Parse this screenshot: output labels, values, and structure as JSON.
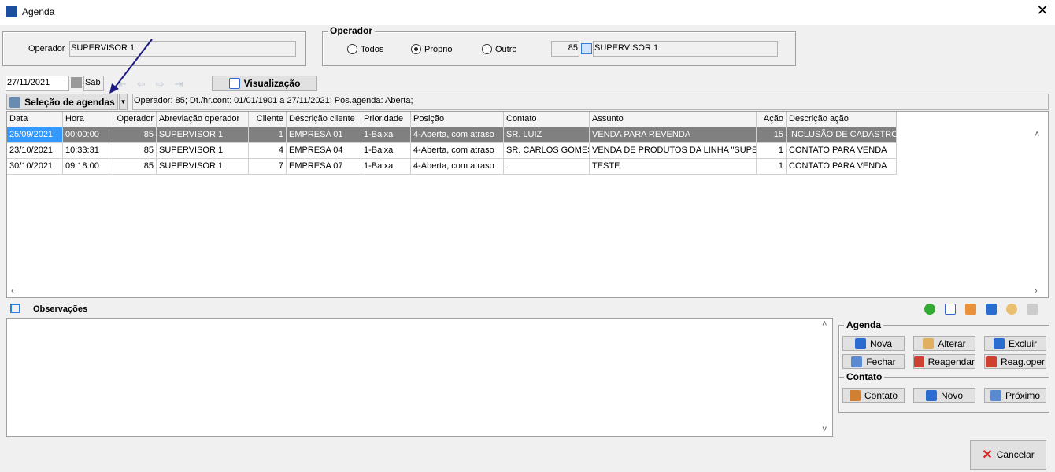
{
  "window": {
    "title": "Agenda",
    "close_icon": "close-icon"
  },
  "operator_panel": {
    "label": "Operador",
    "value": "SUPERVISOR 1"
  },
  "operator_filter": {
    "legend": "Operador",
    "options": [
      {
        "label": "Todos",
        "selected": false
      },
      {
        "label": "Próprio",
        "selected": true
      },
      {
        "label": "Outro",
        "selected": false
      }
    ],
    "code": "85",
    "name": "SUPERVISOR 1"
  },
  "date_bar": {
    "date": "27/11/2021",
    "weekday": "Sáb",
    "view_button": "Visualização"
  },
  "selection": {
    "button": "Seleção de agendas",
    "summary": "Operador: 85; Dt./hr.cont: 01/01/1901 a 27/11/2021; Pos.agenda: Aberta;"
  },
  "table": {
    "columns": [
      "Data",
      "Hora",
      "Operador",
      "Abreviação operador",
      "Cliente",
      "Descrição cliente",
      "Prioridade",
      "Posição",
      "Contato",
      "Assunto",
      "Ação",
      "Descrição ação"
    ],
    "rows": [
      [
        "25/09/2021",
        "00:00:00",
        "85",
        "SUPERVISOR 1",
        "1",
        "EMPRESA 01",
        "1-Baixa",
        "4-Aberta, com atraso",
        "SR. LUIZ",
        "VENDA PARA REVENDA",
        "15",
        "INCLUSÃO DE CADASTRO"
      ],
      [
        "23/10/2021",
        "10:33:31",
        "85",
        "SUPERVISOR 1",
        "4",
        "EMPRESA 04",
        "1-Baixa",
        "4-Aberta, com atraso",
        "SR. CARLOS GOMES",
        "VENDA DE PRODUTOS DA LINHA \"SUPER\"",
        "1",
        "CONTATO PARA VENDA"
      ],
      [
        "30/10/2021",
        "09:18:00",
        "85",
        "SUPERVISOR 1",
        "7",
        "EMPRESA 07",
        "1-Baixa",
        "4-Aberta, com atraso",
        ".",
        "TESTE",
        "1",
        "CONTATO PARA VENDA"
      ]
    ],
    "selected_row": 0
  },
  "observations": {
    "label": "Observações"
  },
  "agenda_group": {
    "legend": "Agenda",
    "buttons": [
      "Nova",
      "Alterar",
      "Excluir",
      "Fechar",
      "Reagendar",
      "Reag.oper"
    ]
  },
  "contato_group": {
    "legend": "Contato",
    "buttons": [
      "Contato",
      "Novo",
      "Próximo"
    ]
  },
  "footer": {
    "cancel": "Cancelar"
  },
  "colors": {
    "selected_row": "#808080",
    "selected_cell": "#3399ff",
    "annotation_arrow": "#1a1a80"
  }
}
